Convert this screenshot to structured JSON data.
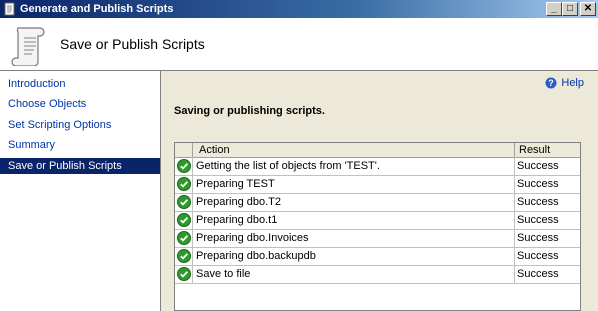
{
  "window": {
    "title": "Generate and Publish Scripts",
    "min_label": "_",
    "max_label": "□",
    "close_label": "✕"
  },
  "header": {
    "title": "Save or Publish Scripts"
  },
  "nav": {
    "items": [
      {
        "label": "Introduction",
        "active": false
      },
      {
        "label": "Choose Objects",
        "active": false
      },
      {
        "label": "Set Scripting Options",
        "active": false
      },
      {
        "label": "Summary",
        "active": false
      },
      {
        "label": "Save or Publish Scripts",
        "active": true
      }
    ]
  },
  "main": {
    "help_label": "Help",
    "section_title": "Saving or publishing scripts.",
    "grid": {
      "columns": {
        "action": "Action",
        "result": "Result"
      },
      "rows": [
        {
          "action": "Getting the list of objects from 'TEST'.",
          "result": "Success"
        },
        {
          "action": "Preparing TEST",
          "result": "Success"
        },
        {
          "action": "Preparing dbo.T2",
          "result": "Success"
        },
        {
          "action": "Preparing dbo.t1",
          "result": "Success"
        },
        {
          "action": "Preparing dbo.Invoices",
          "result": "Success"
        },
        {
          "action": "Preparing dbo.backupdb",
          "result": "Success"
        },
        {
          "action": "Save to file",
          "result": "Success"
        }
      ]
    }
  },
  "colors": {
    "accent": "#0a246a",
    "link": "#0033aa",
    "success": "#2e9a2e"
  }
}
